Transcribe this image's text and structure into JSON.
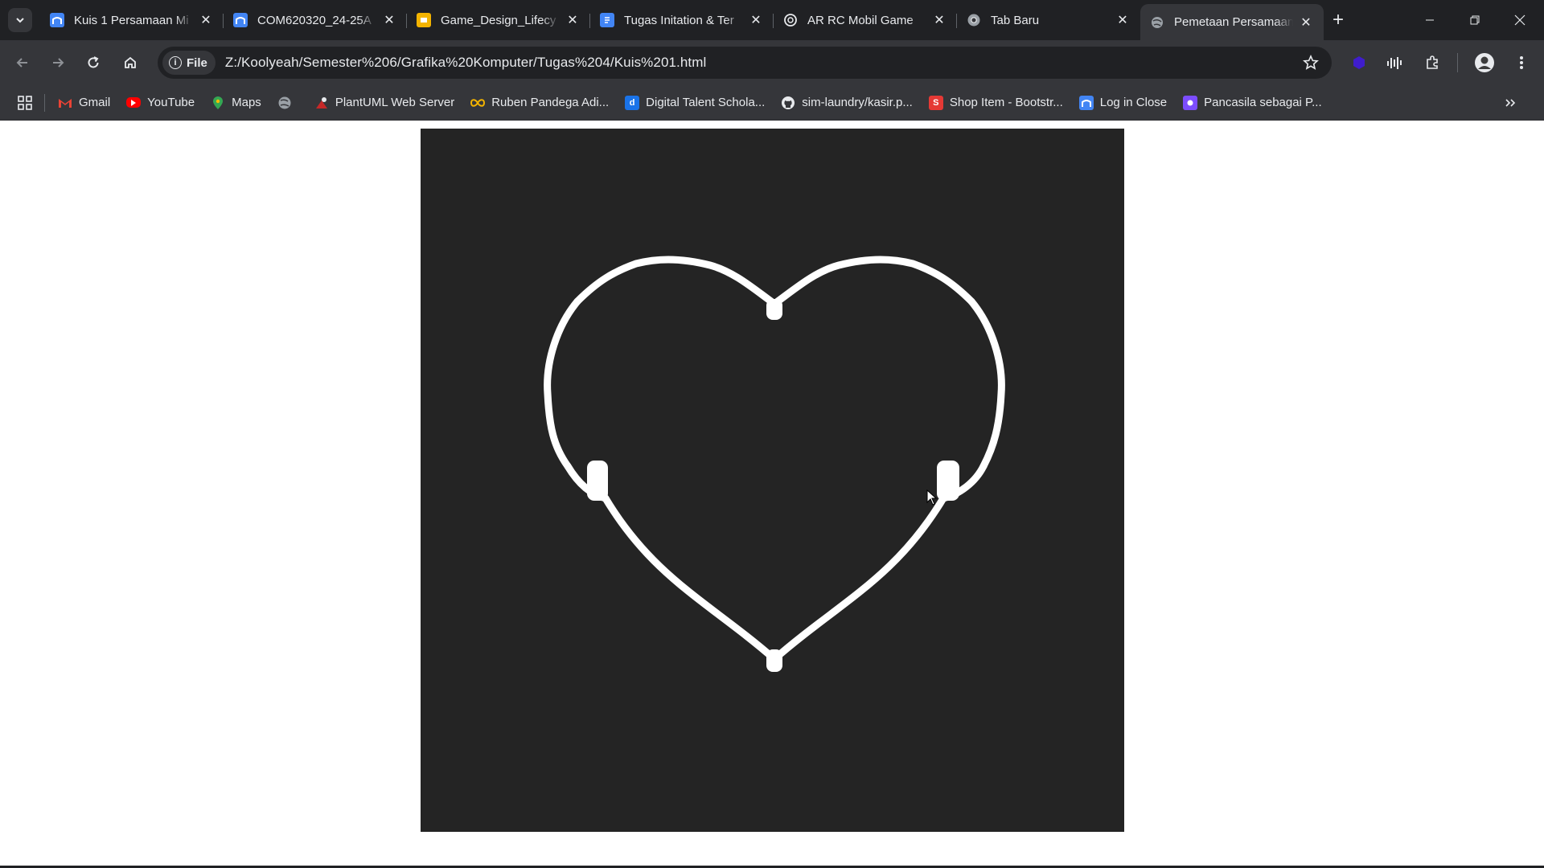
{
  "browser": {
    "tabs": [
      {
        "title": "Kuis 1 Persamaan Mi",
        "favicon": "moodle-icon",
        "color": "#4285f4"
      },
      {
        "title": "COM620320_24-25A",
        "favicon": "moodle-icon",
        "color": "#4285f4"
      },
      {
        "title": "Game_Design_Lifecy",
        "favicon": "slides-icon",
        "color": "#f4b400"
      },
      {
        "title": "Tugas Initation & Ter",
        "favicon": "docs-icon",
        "color": "#4285f4"
      },
      {
        "title": "AR RC Mobil Game",
        "favicon": "chatgpt-icon",
        "color": "#e8eaed"
      },
      {
        "title": "Tab Baru",
        "favicon": "chrome-icon",
        "color": "#e8eaed"
      },
      {
        "title": "Pemetaan Persamaan",
        "favicon": "globe-icon",
        "color": "#e8eaed",
        "active": true
      }
    ],
    "new_tab_label": "+",
    "address": {
      "chip": "File",
      "url": "Z:/Koolyeah/Semester%206/Grafika%20Komputer/Tugas%204/Kuis%201.html"
    },
    "bookmarks": [
      {
        "label": "Gmail",
        "icon": "gmail-icon",
        "color": "#ea4335"
      },
      {
        "label": "YouTube",
        "icon": "youtube-icon",
        "color": "#ff0000"
      },
      {
        "label": "Maps",
        "icon": "maps-icon",
        "color": "#34a853"
      },
      {
        "label": "",
        "icon": "globe-icon",
        "color": "#e8eaed"
      },
      {
        "label": "PlantUML Web Server",
        "icon": "plantuml-icon",
        "color": "#d33"
      },
      {
        "label": "Ruben Pandega Adi...",
        "icon": "infinity-icon",
        "color": "#f4b400"
      },
      {
        "label": "Digital Talent Schola...",
        "icon": "dts-icon",
        "color": "#1a73e8"
      },
      {
        "label": "sim-laundry/kasir.p...",
        "icon": "github-icon",
        "color": "#e8eaed"
      },
      {
        "label": "Shop Item - Bootstr...",
        "icon": "s-icon",
        "color": "#e53935"
      },
      {
        "label": "Log in Close",
        "icon": "moodle-icon",
        "color": "#4285f4"
      },
      {
        "label": "Pancasila sebagai P...",
        "icon": "web-icon",
        "color": "#7c4dff"
      }
    ]
  },
  "canvas": {
    "background": "#242424",
    "stroke": "#ffffff"
  }
}
